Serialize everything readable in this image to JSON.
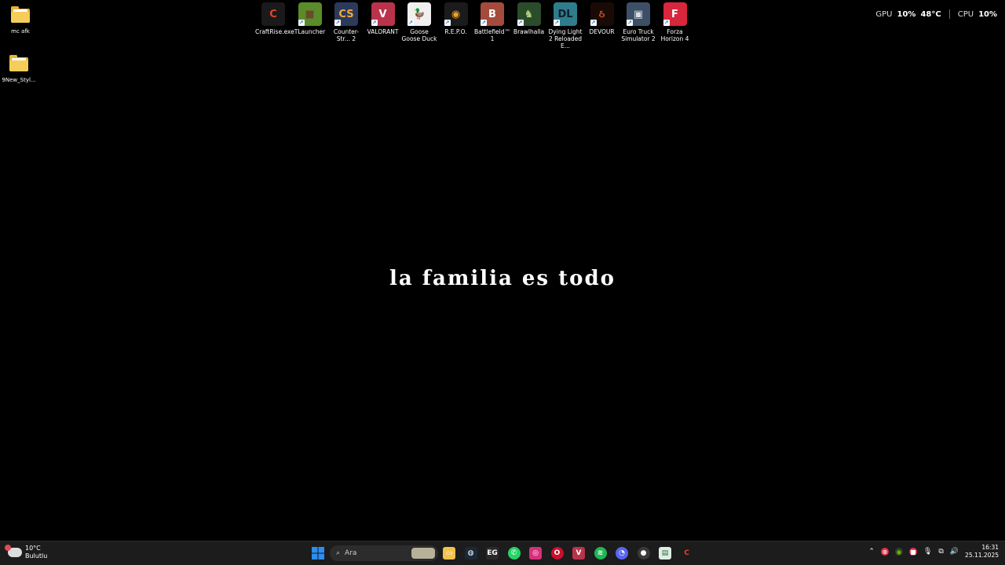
{
  "desktop": {
    "left_icons": [
      {
        "label": "mc afk"
      },
      {
        "label": "9New_Styl..."
      }
    ],
    "games": [
      {
        "label": "CraftRise.exe",
        "color": "#1a1a1a",
        "glyph": "C",
        "glyph_color": "#e5432c"
      },
      {
        "label": "TLauncher",
        "color": "#5a8c2a",
        "glyph": "■",
        "glyph_color": "#6b4a2b"
      },
      {
        "label": "Counter-Str... 2",
        "color": "#2b3a5b",
        "glyph": "CS",
        "glyph_color": "#f2a93b"
      },
      {
        "label": "VALORANT",
        "color": "#b9334b",
        "glyph": "V",
        "glyph_color": "#ffffff"
      },
      {
        "label": "Goose Goose Duck",
        "color": "#f0f0f0",
        "glyph": "🦆",
        "glyph_color": "#222222"
      },
      {
        "label": "R.E.P.O.",
        "color": "#1b1b1b",
        "glyph": "◉",
        "glyph_color": "#f0a226"
      },
      {
        "label": "Battlefield™ 1",
        "color": "#a44b3c",
        "glyph": "B",
        "glyph_color": "#ffffff"
      },
      {
        "label": "Brawlhalla",
        "color": "#2b4c2b",
        "glyph": "♞",
        "glyph_color": "#b0d07a"
      },
      {
        "label": "Dying Light 2 Reloaded E...",
        "color": "#2f7c8c",
        "glyph": "DL",
        "glyph_color": "#0d1f2a"
      },
      {
        "label": "DEVOUR",
        "color": "#1a0a06",
        "glyph": "ઠ",
        "glyph_color": "#d4502a"
      },
      {
        "label": "Euro Truck Simulator 2",
        "color": "#3d4f66",
        "glyph": "▣",
        "glyph_color": "#d9dde2"
      },
      {
        "label": "Forza Horizon 4",
        "color": "#d8263d",
        "glyph": "F",
        "glyph_color": "#ffffff"
      }
    ],
    "motto": "la familia es todo"
  },
  "monitor": {
    "gpu_label": "GPU",
    "gpu_usage": "10%",
    "gpu_temp": "48°C",
    "cpu_label": "CPU",
    "cpu_usage": "10%"
  },
  "taskbar": {
    "weather_temp": "10°C",
    "weather_desc": "Bulutlu",
    "search_placeholder": "Ara",
    "apps": [
      {
        "name": "start-button",
        "color": "#2b8ef0",
        "glyph": "⊞"
      },
      {
        "name": "file-explorer-icon",
        "color": "#f3c24b",
        "glyph": "▭"
      },
      {
        "name": "steam-icon",
        "color": "#1b2838",
        "glyph": "◍"
      },
      {
        "name": "epic-games-icon",
        "color": "#2a2a2a",
        "glyph": "EG"
      },
      {
        "name": "whatsapp-icon",
        "color": "#25d366",
        "glyph": "✆"
      },
      {
        "name": "instagram-icon",
        "color": "#d6307b",
        "glyph": "◎"
      },
      {
        "name": "opera-icon",
        "color": "#c8102e",
        "glyph": "O"
      },
      {
        "name": "valorant-taskbar-icon",
        "color": "#b9334b",
        "glyph": "V"
      },
      {
        "name": "spotify-icon",
        "color": "#1db954",
        "glyph": "≋"
      },
      {
        "name": "discord-icon",
        "color": "#5865f2",
        "glyph": "◔"
      },
      {
        "name": "obs-icon",
        "color": "#3a3a3a",
        "glyph": "●"
      },
      {
        "name": "notepad-icon",
        "color": "#dfeee4",
        "glyph": "▤"
      },
      {
        "name": "craftrise-taskbar-icon",
        "color": "#1c1c1c",
        "glyph": "C"
      }
    ],
    "clock_time": "16:31",
    "clock_date": "25.11.2025"
  }
}
